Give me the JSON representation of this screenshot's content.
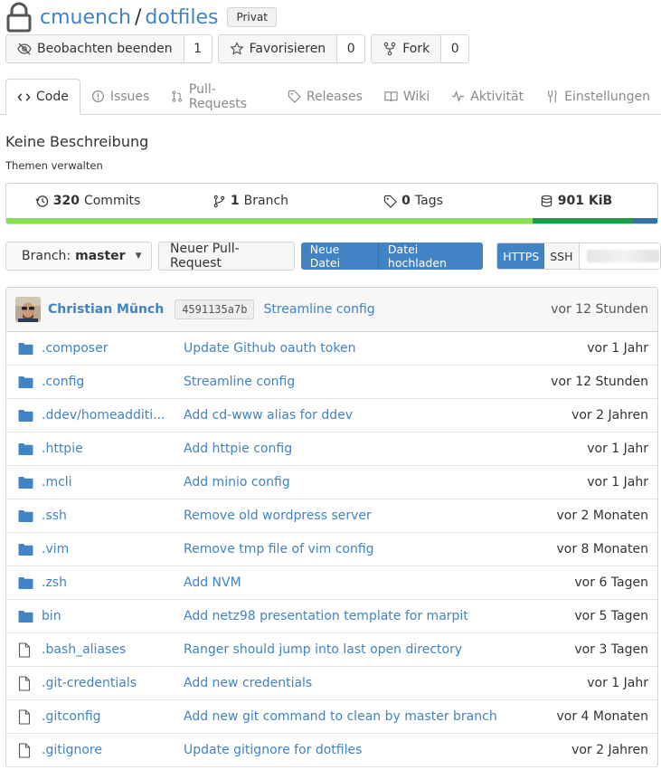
{
  "repo": {
    "owner": "cmuench",
    "separator": "/",
    "name": "dotfiles",
    "visibility": "Privat"
  },
  "actions": [
    {
      "label": "Beobachten beenden",
      "count": "1",
      "icon": "eye-slash-icon"
    },
    {
      "label": "Favorisieren",
      "count": "0",
      "icon": "star-icon"
    },
    {
      "label": "Fork",
      "count": "0",
      "icon": "fork-icon"
    }
  ],
  "tabs": [
    {
      "label": "Code",
      "icon": "code-icon",
      "active": true
    },
    {
      "label": "Issues",
      "icon": "issue-icon"
    },
    {
      "label": "Pull-Requests",
      "icon": "pull-request-icon"
    },
    {
      "label": "Releases",
      "icon": "tag-icon"
    },
    {
      "label": "Wiki",
      "icon": "book-icon"
    },
    {
      "label": "Aktivität",
      "icon": "pulse-icon"
    },
    {
      "label": "Einstellungen",
      "icon": "tools-icon"
    }
  ],
  "description": "Keine Beschreibung",
  "topics_link": "Themen verwalten",
  "stats": {
    "commits_count": "320",
    "commits_label": "Commits",
    "branches_count": "1",
    "branches_label": "Branch",
    "tags_count": "0",
    "tags_label": "Tags",
    "size_value": "901 KiB"
  },
  "language_bar": [
    {
      "color": "#89e051",
      "fraction": 0.808
    },
    {
      "color": "#199f4b",
      "fraction": 0.155
    },
    {
      "color": "#3572a5",
      "fraction": 0.037
    }
  ],
  "toolbar": {
    "branch_prefix": "Branch:",
    "branch_name": "master",
    "new_pr": "Neuer Pull-Request",
    "new_file": "Neue Datei",
    "upload_file": "Datei hochladen",
    "https": "HTTPS",
    "ssh": "SSH"
  },
  "latest_commit": {
    "author": "Christian Münch",
    "sha": "4591135a7b",
    "message": "Streamline config",
    "time": "vor 12 Stunden"
  },
  "files": [
    {
      "type": "folder",
      "name": ".composer",
      "message": "Update Github oauth token",
      "time": "vor 1 Jahr"
    },
    {
      "type": "folder",
      "name": ".config",
      "message": "Streamline config",
      "time": "vor 12 Stunden"
    },
    {
      "type": "folder",
      "name": ".ddev/homeadditi...",
      "message": "Add cd-www alias for ddev",
      "time": "vor 2 Jahren"
    },
    {
      "type": "folder",
      "name": ".httpie",
      "message": "Add httpie config",
      "time": "vor 1 Jahr"
    },
    {
      "type": "folder",
      "name": ".mcli",
      "message": "Add minio config",
      "time": "vor 1 Jahr"
    },
    {
      "type": "folder",
      "name": ".ssh",
      "message": "Remove old wordpress server",
      "time": "vor 2 Monaten"
    },
    {
      "type": "folder",
      "name": ".vim",
      "message": "Remove tmp file of vim config",
      "time": "vor 8 Monaten"
    },
    {
      "type": "folder",
      "name": ".zsh",
      "message": "Add NVM",
      "time": "vor 6 Tagen"
    },
    {
      "type": "folder",
      "name": "bin",
      "message": "Add netz98 presentation template for marpit",
      "time": "vor 5 Tagen"
    },
    {
      "type": "file",
      "name": ".bash_aliases",
      "message": "Ranger should jump into last open directory",
      "time": "vor 3 Tagen"
    },
    {
      "type": "file",
      "name": ".git-credentials",
      "message": "Add new credentials",
      "time": "vor 1 Jahr"
    },
    {
      "type": "file",
      "name": ".gitconfig",
      "message": "Add new git command to clean by master branch",
      "time": "vor 4 Monaten"
    },
    {
      "type": "file",
      "name": ".gitignore",
      "message": "Update gitignore for dotfiles",
      "time": "vor 2 Jahren"
    }
  ]
}
